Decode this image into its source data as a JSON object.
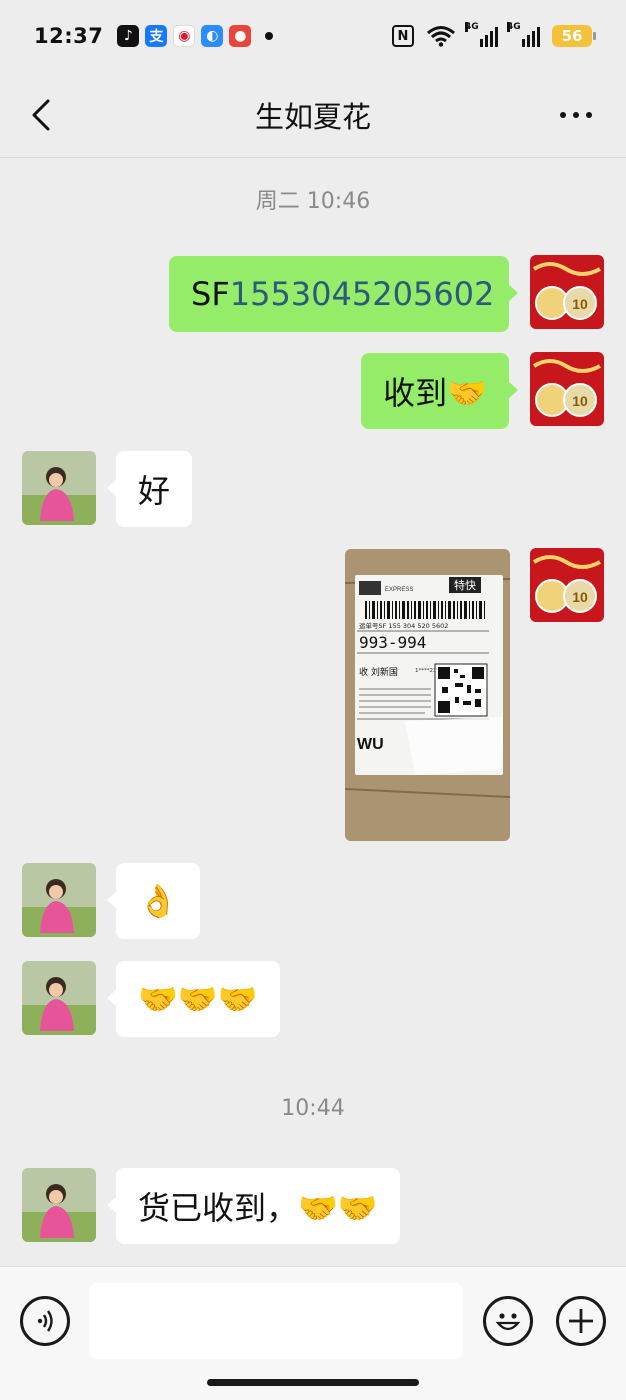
{
  "status_bar": {
    "time": "12:37",
    "battery": "56",
    "network_1": "4G",
    "network_2": "4G",
    "nfc": "N",
    "app_icons": [
      "tiktok-icon",
      "alipay-icon",
      "weibo-icon",
      "browser-icon",
      "app-icon"
    ],
    "alipay_glyph": "支"
  },
  "header": {
    "title": "生如夏花"
  },
  "chat": {
    "timestamp_1": "周二 10:46",
    "timestamp_2": "10:44",
    "messages": [
      {
        "direction": "out",
        "type": "text",
        "prefix": "SF",
        "number": "1553045205602"
      },
      {
        "direction": "out",
        "type": "text",
        "text": "收到🤝"
      },
      {
        "direction": "in",
        "type": "text",
        "text": "好"
      },
      {
        "direction": "out",
        "type": "image",
        "image": {
          "brand": "EXPRESS",
          "service": "特快",
          "waybill": "运单号SF 155 304 520 5602",
          "code": "993-994",
          "recipient": "收 刘新国",
          "phone": "1****2363",
          "area": "WU"
        }
      },
      {
        "direction": "in",
        "type": "emoji",
        "text": "👌"
      },
      {
        "direction": "in",
        "type": "emoji",
        "text": "🤝🤝🤝"
      },
      {
        "direction": "in",
        "type": "text",
        "text": "货已收到，🤝🤝"
      }
    ]
  },
  "input_bar": {
    "placeholder": "",
    "icons": [
      "voice-icon",
      "emoji-icon",
      "plus-icon"
    ]
  },
  "colors": {
    "background": "#ededed",
    "out_bubble": "#95ec69",
    "in_bubble": "#ffffff",
    "number_link": "#2b5a7c",
    "battery": "#f4c13b"
  }
}
